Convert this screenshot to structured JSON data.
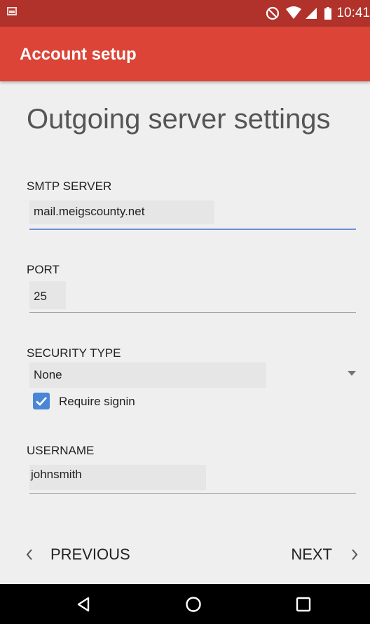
{
  "status_bar": {
    "time": "10:41",
    "icons": [
      "image-notification-icon",
      "do-not-disturb-icon",
      "wifi-icon",
      "signal-icon",
      "battery-icon"
    ]
  },
  "app_bar": {
    "title": "Account setup"
  },
  "page": {
    "title": "Outgoing server settings"
  },
  "smtp": {
    "label": "SMTP SERVER",
    "value": "mail.meigscounty.net"
  },
  "port": {
    "label": "PORT",
    "value": "25"
  },
  "security": {
    "label": "SECURITY TYPE",
    "selected": "None",
    "require_signin_label": "Require signin",
    "require_signin_checked": true
  },
  "username": {
    "label": "USERNAME",
    "value": "johnsmith"
  },
  "nav": {
    "previous": "PREVIOUS",
    "next": "NEXT"
  },
  "colors": {
    "status_bar": "#b0322a",
    "app_bar": "#db4437",
    "accent": "#4a86d6"
  },
  "system_nav": {
    "icons": [
      "back-icon",
      "home-icon",
      "recents-icon"
    ]
  }
}
